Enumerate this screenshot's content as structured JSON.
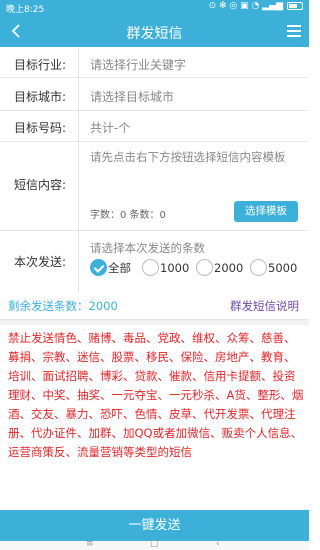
{
  "status_bar": {
    "time": "晚上8:25",
    "icons_text": "⊙ ✻ ◎ ▣ ◔ ▂▄▆"
  },
  "header": {
    "title": "群发短信"
  },
  "form": {
    "industry": {
      "label": "目标行业:",
      "placeholder": "请选择行业关键字"
    },
    "city": {
      "label": "目标城市:",
      "placeholder": "请选择目标城市"
    },
    "numbers": {
      "label": "目标号码:",
      "value": "共计-个"
    },
    "content": {
      "label": "短信内容:",
      "placeholder": "请先点击右下方按钮选择短信内容模板",
      "counter": "字数：0 条数：0",
      "select_button": "选择模板"
    },
    "send_count": {
      "label": "本次发送:",
      "hint": "请选择本次发送的条数",
      "options": [
        "全部",
        "1000",
        "2000",
        "5000"
      ],
      "selected": "全部"
    }
  },
  "remaining": "剩余发送条数：2000",
  "explain_link": "群发短信说明",
  "warning": "禁止发送情色、赌博、毒品、党政、维权、众筹、慈善、募捐、宗教、迷信、股票、移民、保险、房地产、教育、培训、面试招聘、博彩、贷款、催款、信用卡提额、投资理财、中奖、抽奖、一元夺宝、一元秒杀、A货、整形、烟酒、交友、暴力、恐吓、色情、皮草、代开发票、代理注册、代办证件、加群、加QQ或者加微信、贩卖个人信息、运营商策反、流量营销等类型的短信",
  "send_button": "一键发送",
  "colors": {
    "accent": "#3cb0d9",
    "warning": "#e0252a",
    "link": "#6a4aa8"
  }
}
